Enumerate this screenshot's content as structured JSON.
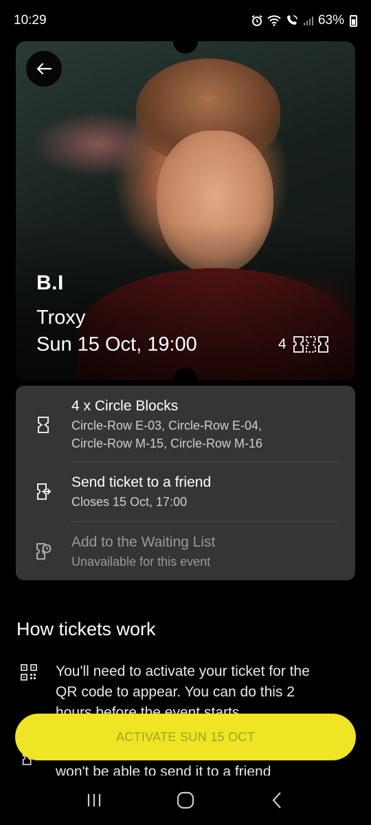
{
  "status_bar": {
    "time": "10:29",
    "battery": "63%",
    "icons": [
      "alarm-icon",
      "wifi-icon",
      "wifi-calling-icon",
      "signal-icon",
      "battery-icon"
    ]
  },
  "event": {
    "artist": "B.I",
    "venue": "Troxy",
    "date_time": "Sun 15 Oct, 19:00",
    "ticket_count": "4"
  },
  "ticket_info": {
    "tickets": {
      "title": "4 x Circle Blocks",
      "seats_line1": "Circle-Row E-03, Circle-Row E-04,",
      "seats_line2": "Circle-Row M-15, Circle-Row M-16"
    },
    "send": {
      "title": "Send ticket to a friend",
      "subtitle": "Closes 15 Oct, 17:00"
    },
    "waiting": {
      "title": "Add to the Waiting List",
      "subtitle": "Unavailable for this event"
    }
  },
  "how_it_works": {
    "title": "How tickets work",
    "item1_line1": "You'll need to activate your ticket for the",
    "item1_line2": "QR code to appear. You can do this 2",
    "item1_line3": "hours before the event starts.",
    "item2_line": "won't be able to send it to a friend"
  },
  "activate": {
    "label": "ACTIVATE SUN 15 OCT"
  },
  "colors": {
    "accent": "#efe524",
    "card": "#353535",
    "background": "#000000"
  }
}
